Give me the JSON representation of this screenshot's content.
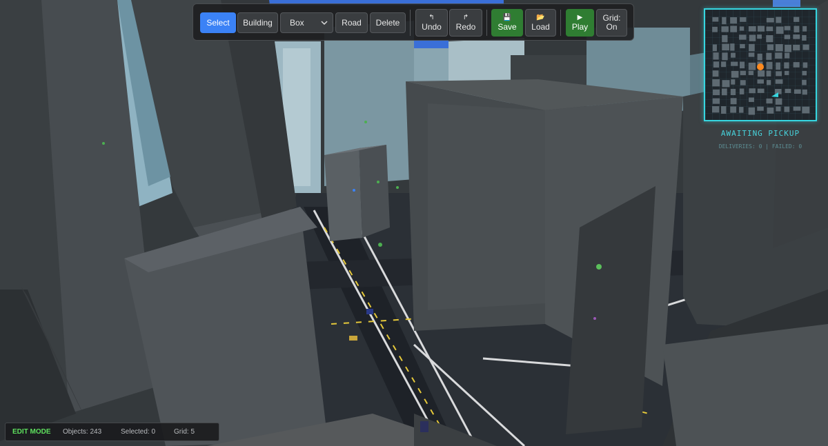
{
  "toolbar": {
    "select_label": "Select",
    "building_label": "Building",
    "shape_value": "Box",
    "road_label": "Road",
    "delete_label": "Delete",
    "undo_label": "Undo",
    "redo_label": "Redo",
    "save_label": "Save",
    "load_label": "Load",
    "play_label": "Play",
    "grid_label": "Grid:",
    "grid_value": "On",
    "undo_icon": "↰",
    "redo_icon": "↱",
    "save_icon": "💾",
    "load_icon": "📂",
    "play_icon": "▶"
  },
  "status": {
    "title": "AWAITING PICKUP",
    "counts": "DELIVERIES: 0 | FAILED: 0"
  },
  "footer": {
    "mode": "EDIT MODE",
    "objects": "Objects: 243",
    "selected": "Selected: 0",
    "grid": "Grid: 5"
  },
  "colors": {
    "accent": "#3b82f6",
    "save_green": "#2f7d32",
    "minimap_border": "#36d6e0",
    "edit_mode": "#5ee05e",
    "pickup_marker": "#ff8a1f"
  }
}
